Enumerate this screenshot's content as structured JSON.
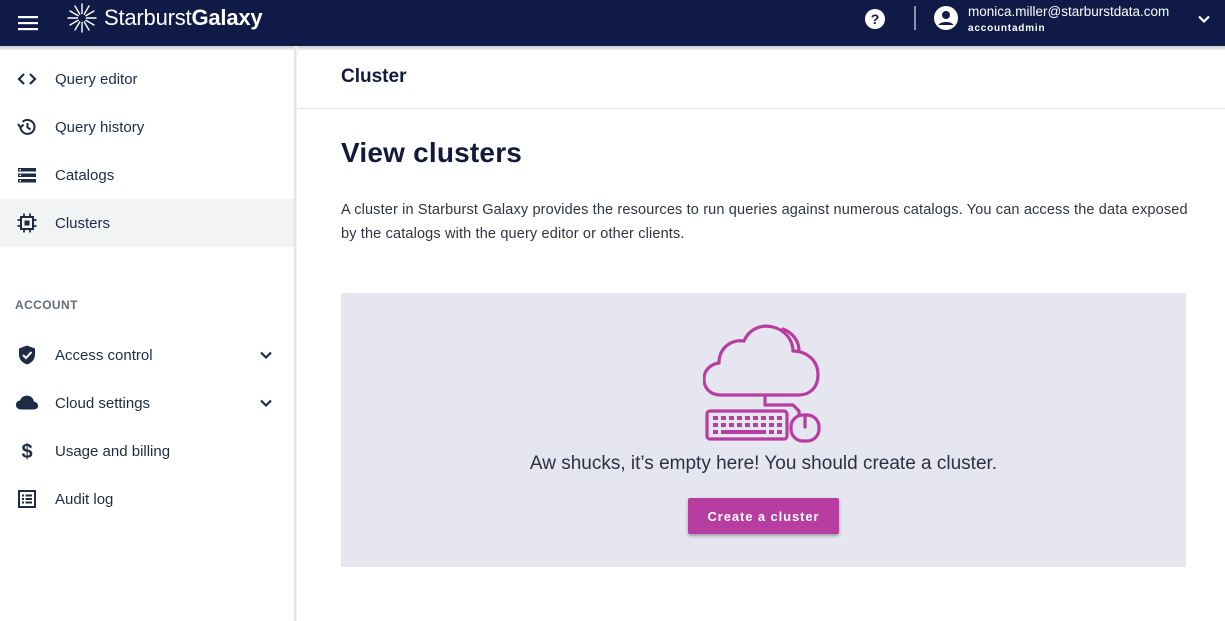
{
  "topbar": {
    "logo_light": "Starburst",
    "logo_bold": "Galaxy",
    "user_email": "monica.miller@starburstdata.com",
    "user_role": "accountadmin"
  },
  "sidebar": {
    "items": [
      {
        "label": "Query editor",
        "icon": "code-icon"
      },
      {
        "label": "Query history",
        "icon": "history-icon"
      },
      {
        "label": "Catalogs",
        "icon": "list-icon"
      },
      {
        "label": "Clusters",
        "icon": "chip-icon",
        "active": true
      }
    ],
    "section_label": "ACCOUNT",
    "account_items": [
      {
        "label": "Access control",
        "icon": "shield-icon",
        "expandable": true
      },
      {
        "label": "Cloud settings",
        "icon": "cloud-icon",
        "expandable": true
      },
      {
        "label": "Usage and billing",
        "icon": "dollar-icon"
      },
      {
        "label": "Audit log",
        "icon": "list-alt-icon"
      }
    ]
  },
  "main": {
    "header_title": "Cluster",
    "page_title": "View clusters",
    "description": "A cluster in Starburst Galaxy provides the resources to run queries against numerous catalogs. You can access the data exposed by the catalogs with the query editor or other clients.",
    "empty_state": {
      "message": "Aw shucks, it’s empty here! You should create a cluster.",
      "button_label": "Create a cluster"
    }
  },
  "colors": {
    "topbar": "#0f1a47",
    "accent": "#b83da0",
    "panel": "#e5e6ef",
    "title": "#12193d"
  }
}
